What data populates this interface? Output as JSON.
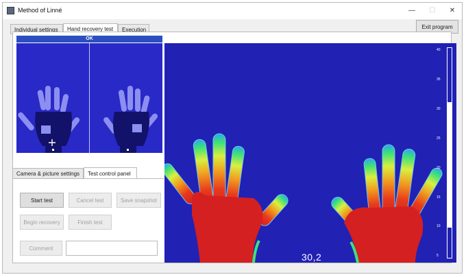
{
  "window": {
    "title": "Method of Linné",
    "minimize": "—",
    "maximize": "☐",
    "close": "✕"
  },
  "tabs": [
    "Individual settings",
    "Hand recovery test",
    "Execution"
  ],
  "exit_button": "Exit program",
  "status": "OK",
  "subtabs": [
    "Camera & picture settings",
    "Test control panel"
  ],
  "buttons": {
    "start_test": "Start test",
    "cancel_test": "Cancel test",
    "save_snapshot": "Save snapshot",
    "begin_recovery": "Begin recovery",
    "finish_test": "Finish test",
    "comment": "Comment"
  },
  "comment_value": "",
  "temperature_readout": "30,2",
  "scale": {
    "ticks": [
      "40",
      "35",
      "30",
      "25",
      "20",
      "15",
      "10",
      "5"
    ],
    "range": [
      5,
      40
    ],
    "fill_band": [
      10,
      31
    ]
  },
  "colors": {
    "thermal_bg": "#2121b4",
    "preview_bg": "#2929c8",
    "hot": "#d42020",
    "status_bar": "#2b4fbf"
  }
}
